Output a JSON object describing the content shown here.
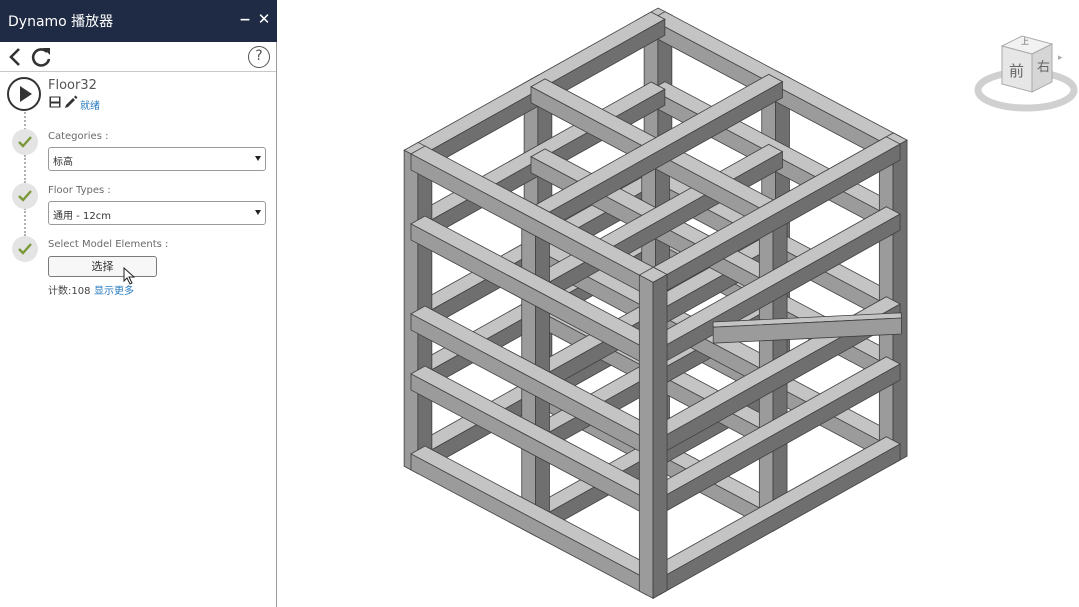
{
  "window": {
    "title": "Dynamo 播放器"
  },
  "script": {
    "name": "Floor32",
    "status": "就绪"
  },
  "inputs": [
    {
      "label": "Categories :",
      "value": "标高"
    },
    {
      "label": "Floor Types :",
      "value": "通用 - 12cm"
    },
    {
      "label": "Select Model Elements :",
      "button": "选择",
      "count": "计数:108",
      "more": "显示更多"
    }
  ],
  "viewcube": {
    "front": "前",
    "right": "右",
    "top": "上"
  },
  "colors": {
    "titlebar": "#1f2a44",
    "link": "#2a7bc0",
    "check": "#7a9a3a",
    "steel_light": "#c4c4c4",
    "steel_mid": "#9b9b9b",
    "steel_dark": "#6f6f6f"
  }
}
